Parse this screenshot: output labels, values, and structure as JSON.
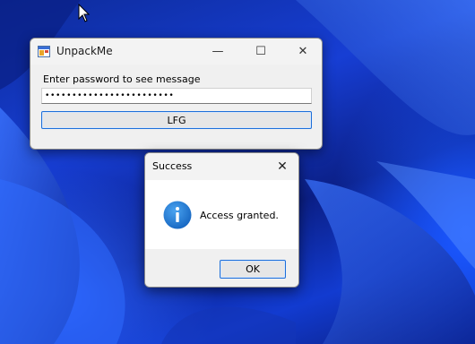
{
  "main_window": {
    "title": "UnpackMe",
    "prompt_label": "Enter password to see message",
    "password_value": "••••••••••••••••••••••••",
    "submit_label": "LFG",
    "minimize_glyph": "—",
    "maximize_glyph": "☐",
    "close_glyph": "✕",
    "app_icon": "app-window-icon"
  },
  "message_box": {
    "title": "Success",
    "message": "Access granted.",
    "ok_label": "OK",
    "close_glyph": "✕",
    "icon": "info-icon"
  },
  "colors": {
    "accent_border": "#1e6fd9",
    "info_icon": "#1976d2",
    "wallpaper": "#1a3fc8"
  }
}
